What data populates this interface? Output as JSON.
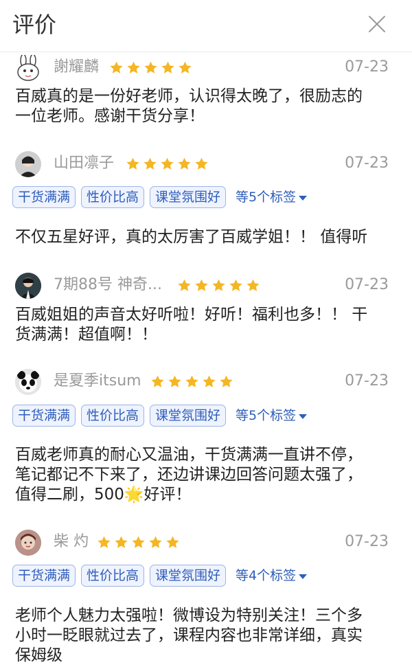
{
  "header": {
    "title": "评价",
    "close_icon": "close-icon"
  },
  "colors": {
    "star": "#f5b623",
    "tag_border": "#9db4e4",
    "tag_bg": "#eef3ff",
    "tag_text": "#2f5db8",
    "muted": "#9a9a9a"
  },
  "reviews": [
    {
      "name": "謝耀麟",
      "rating": 5,
      "date": "07-23",
      "tags": [],
      "more_tags": "",
      "content_lines": [
        "百威真的是一份好老师，认识得太晚了，很励志的",
        "一位老师。感谢干货分享！"
      ]
    },
    {
      "name": "山田凛子",
      "rating": 5,
      "date": "07-23",
      "tags": [
        "干货满满",
        "性价比高",
        "课堂氛围好"
      ],
      "more_tags": "等5个标签",
      "content_lines": [
        "不仅五星好评，真的太厉害了百威学姐！！ 值得听"
      ]
    },
    {
      "name": "7期88号 神奇...",
      "rating": 5,
      "date": "07-23",
      "tags": [],
      "more_tags": "",
      "content_lines": [
        "百威姐姐的声音太好听啦！好听！福利也多！！ 干",
        "货满满！超值啊！！"
      ]
    },
    {
      "name": "是夏季itsum",
      "rating": 5,
      "date": "07-23",
      "tags": [
        "干货满满",
        "性价比高",
        "课堂氛围好"
      ],
      "more_tags": "等5个标签",
      "content_lines": [
        "百威老师真的耐心又温油，干货满满一直讲不停，",
        "笔记都记不下来了，还边讲课边回答问题太强了，",
        "值得二刷，500🌟好评！"
      ]
    },
    {
      "name": "柴 灼",
      "rating": 5,
      "date": "07-23",
      "tags": [
        "干货满满",
        "性价比高",
        "课堂氛围好"
      ],
      "more_tags": "等4个标签",
      "content_lines": [
        "老师个人魅力太强啦！微博设为特别关注！三个多",
        "小时一眨眼就过去了，课程内容也非常详细，真实",
        "保姆级"
      ]
    }
  ]
}
